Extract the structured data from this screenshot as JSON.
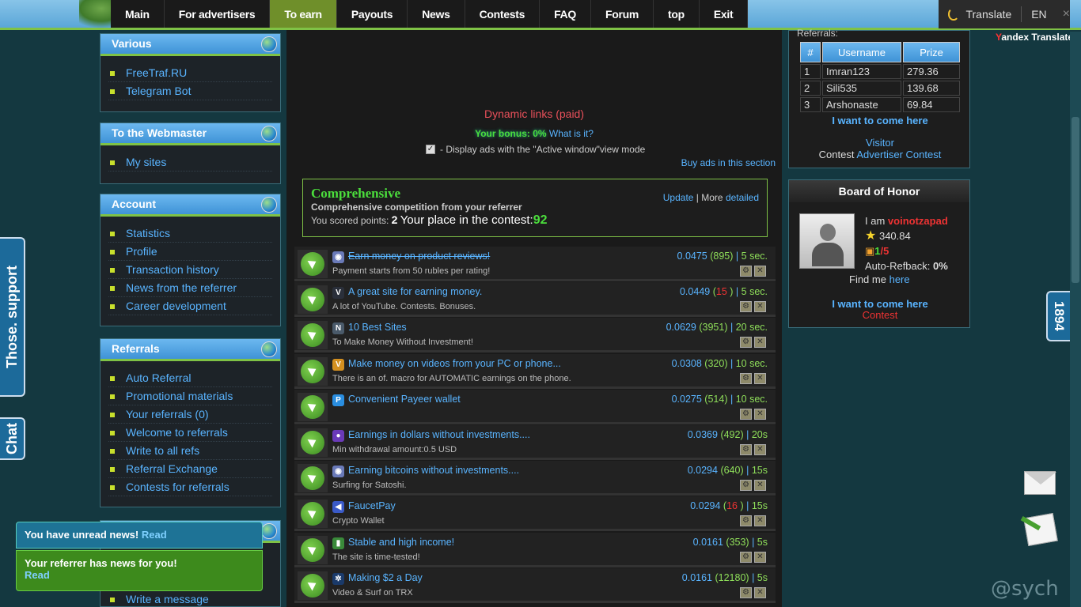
{
  "nav": [
    "Main",
    "For advertisers",
    "To earn",
    "Payouts",
    "News",
    "Contests",
    "FAQ",
    "Forum",
    "top",
    "Exit"
  ],
  "translate": {
    "label": "Translate",
    "lang": "EN",
    "close": "×",
    "brand_y": "Y",
    "brand_rest": "andex Translate"
  },
  "panels": {
    "various": {
      "title": "Various",
      "items": [
        "FreeTraf.RU",
        "Telegram Bot"
      ]
    },
    "webmaster": {
      "title": "To the Webmaster",
      "items": [
        "My sites"
      ]
    },
    "account": {
      "title": "Account",
      "items": [
        "Statistics",
        "Profile",
        "Transaction history",
        "News from the referrer",
        "Career development"
      ]
    },
    "referrals": {
      "title": "Referrals",
      "items": [
        "Auto Referral",
        "Promotional materials",
        "Your referrals (0)",
        "Welcome to referrals",
        "Write to all refs",
        "Referral Exchange",
        "Contests for referrals"
      ]
    },
    "extra_item": "Write a message"
  },
  "side_tabs": {
    "support": "Those. support",
    "chat": "Chat",
    "right": "1894"
  },
  "center": {
    "dynamic_title": "Dynamic links (paid)",
    "bonus_label": "Your bonus: 0%",
    "bonus_link": "What is it?",
    "display_ads": "- Display ads with the \"Active window\"view mode",
    "buy_ads": "Buy ads in this section"
  },
  "competition": {
    "title": "Comprehensive",
    "subtitle": "Comprehensive competition from your referrer",
    "points_label": "You scored points:",
    "points": "2",
    "place_label": "Your place in the contest:",
    "place": "92",
    "update": "Update",
    "more": "More",
    "detailed": "detailed"
  },
  "ads": [
    {
      "title": "Earn money on product reviews!",
      "strike": true,
      "desc": "Payment starts from 50 rubles per rating!",
      "price": "0.0475",
      "count": "895",
      "count_red": false,
      "time": "5 sec.",
      "icon": "globe-icon",
      "icon_color": "#6a7ab8",
      "icon_text": "◉"
    },
    {
      "title": "A great site for earning money.",
      "strike": false,
      "desc": "A lot of YouTube. Contests. Bonuses.",
      "price": "0.0449",
      "count": "15 ",
      "count_red": true,
      "time": "5 sec.",
      "icon": "v-logo-icon",
      "icon_color": "#2a2f3a",
      "icon_text": "V"
    },
    {
      "title": "10 Best Sites",
      "strike": false,
      "desc": "To Make Money Without Investment!",
      "price": "0.0629",
      "count": "3951",
      "count_red": false,
      "time": "20 sec.",
      "icon": "n-logo-icon",
      "icon_color": "#4a5a6a",
      "icon_text": "N"
    },
    {
      "title": "Make money on videos from your PC or phone...",
      "strike": false,
      "desc": "There is an of. macro for AUTOMATIC earnings on the phone.",
      "price": "0.0308",
      "count": "320",
      "count_red": false,
      "time": "10 sec.",
      "icon": "v-gold-icon",
      "icon_color": "#d49020",
      "icon_text": "V"
    },
    {
      "title": "Convenient Payeer wallet",
      "strike": false,
      "desc": "",
      "price": "0.0275",
      "count": "514",
      "count_red": false,
      "time": "10 sec.",
      "icon": "payeer-icon",
      "icon_color": "#2a8ee0",
      "icon_text": "P"
    },
    {
      "title": "Earnings in dollars without investments....",
      "strike": false,
      "desc": "Min withdrawal amount:0.5 USD",
      "price": "0.0369",
      "count": "492",
      "count_red": false,
      "time": "20s",
      "icon": "pin-icon",
      "icon_color": "#6a3ab8",
      "icon_text": "●"
    },
    {
      "title": "Earning bitcoins without investments....",
      "strike": false,
      "desc": "Surfing for Satoshi.",
      "price": "0.0294",
      "count": "640",
      "count_red": false,
      "time": "15s",
      "icon": "globe-icon",
      "icon_color": "#6a7ab8",
      "icon_text": "◉"
    },
    {
      "title": "FaucetPay",
      "strike": false,
      "desc": "Crypto Wallet",
      "price": "0.0294",
      "count": "16 ",
      "count_red": true,
      "time": "15s",
      "icon": "faucetpay-icon",
      "icon_color": "#3a5ac8",
      "icon_text": "◀"
    },
    {
      "title": "Stable and high income!",
      "strike": false,
      "desc": "The site is time-tested!",
      "price": "0.0161",
      "count": "353",
      "count_red": false,
      "time": "5s",
      "icon": "bar-chart-icon",
      "icon_color": "#3a8a3a",
      "icon_text": "▮"
    },
    {
      "title": "Making $2 a Day",
      "strike": false,
      "desc": "Video & Surf on TRX",
      "price": "0.0161",
      "count": "12180",
      "count_red": false,
      "time": "5s",
      "icon": "gear-icon",
      "icon_color": "#1a3a6a",
      "icon_text": "✲"
    }
  ],
  "referrals_box": {
    "label": "Referrals:",
    "headers": [
      "#",
      "Username",
      "Prize"
    ],
    "rows": [
      [
        "1",
        "Imran123",
        "279.36"
      ],
      [
        "2",
        "Sili535",
        "139.68"
      ],
      [
        "3",
        "Arshonaste",
        "69.84"
      ]
    ],
    "come_here": "I want to come here",
    "visitor": "Visitor",
    "contest_label": "Contest",
    "advertiser_contest": "Advertiser Contest"
  },
  "honor": {
    "title": "Board of Honor",
    "i_am": "I am",
    "name": "voinotzapad",
    "score": "340.84",
    "ratio_a": "1",
    "ratio_b": "/5",
    "refback_label": "Auto-Refback:",
    "refback": "0%",
    "find_me": "Find me",
    "here": "here",
    "come_here": "I want to come here",
    "contest": "Contest"
  },
  "notifications": {
    "news": "You have unread news!",
    "news_link": "Read",
    "ref": "Your referrer has news for you!",
    "ref_link": "Read"
  },
  "watermark": "@sych"
}
